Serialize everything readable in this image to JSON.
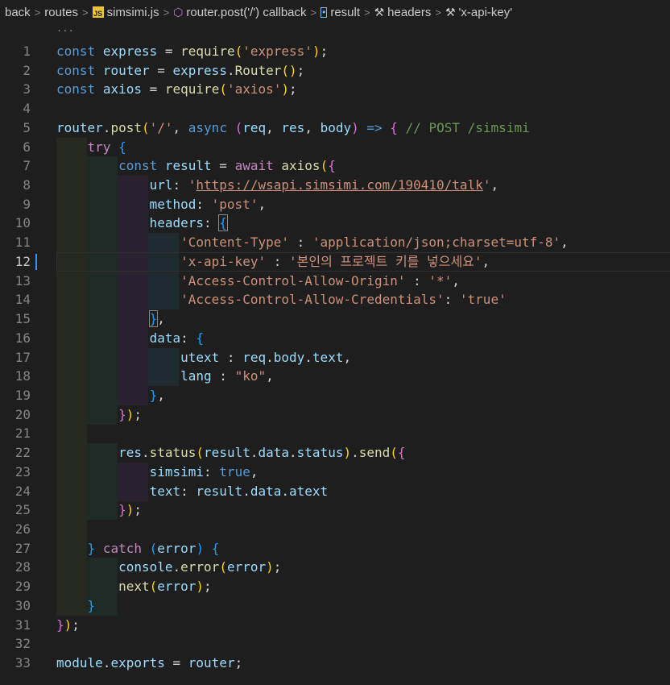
{
  "breadcrumb": {
    "items": [
      {
        "label": "back",
        "icon": null
      },
      {
        "label": "routes",
        "icon": null
      },
      {
        "label": "simsimi.js",
        "icon": "js-file-icon"
      },
      {
        "label": "router.post('/') callback",
        "icon": "cube-icon"
      },
      {
        "label": "result",
        "icon": "variable-icon"
      },
      {
        "label": "headers",
        "icon": "wrench-icon"
      },
      {
        "label": "'x-api-key'",
        "icon": "wrench-icon"
      }
    ],
    "separator": ">"
  },
  "editor": {
    "ellipsis": "...",
    "active_line": 12,
    "line_numbers": [
      "1",
      "2",
      "3",
      "4",
      "5",
      "6",
      "7",
      "8",
      "9",
      "10",
      "11",
      "12",
      "13",
      "14",
      "15",
      "16",
      "17",
      "18",
      "19",
      "20",
      "21",
      "22",
      "23",
      "24",
      "25",
      "26",
      "27",
      "28",
      "29",
      "30",
      "31",
      "32",
      "33"
    ],
    "lines": [
      [
        [
          "k",
          "const"
        ],
        [
          "o",
          " "
        ],
        [
          "v",
          "express"
        ],
        [
          "o",
          " = "
        ],
        [
          "f",
          "require"
        ],
        [
          "b1",
          "("
        ],
        [
          "s",
          "'express'"
        ],
        [
          "b1",
          ")"
        ],
        [
          "o",
          ";"
        ]
      ],
      [
        [
          "k",
          "const"
        ],
        [
          "o",
          " "
        ],
        [
          "v",
          "router"
        ],
        [
          "o",
          " = "
        ],
        [
          "v",
          "express"
        ],
        [
          "o",
          "."
        ],
        [
          "f",
          "Router"
        ],
        [
          "b1",
          "()"
        ],
        [
          "o",
          ";"
        ]
      ],
      [
        [
          "k",
          "const"
        ],
        [
          "o",
          " "
        ],
        [
          "v",
          "axios"
        ],
        [
          "o",
          " = "
        ],
        [
          "f",
          "require"
        ],
        [
          "b1",
          "("
        ],
        [
          "s",
          "'axios'"
        ],
        [
          "b1",
          ")"
        ],
        [
          "o",
          ";"
        ]
      ],
      [],
      [
        [
          "v",
          "router"
        ],
        [
          "o",
          "."
        ],
        [
          "f",
          "post"
        ],
        [
          "b1",
          "("
        ],
        [
          "s",
          "'/'"
        ],
        [
          "o",
          ", "
        ],
        [
          "k",
          "async"
        ],
        [
          "o",
          " "
        ],
        [
          "b2",
          "("
        ],
        [
          "v",
          "req"
        ],
        [
          "o",
          ", "
        ],
        [
          "v",
          "res"
        ],
        [
          "o",
          ", "
        ],
        [
          "v",
          "body"
        ],
        [
          "b2",
          ")"
        ],
        [
          "o",
          " "
        ],
        [
          "k",
          "=>"
        ],
        [
          "o",
          " "
        ],
        [
          "b2",
          "{"
        ],
        [
          "o",
          " "
        ],
        [
          "cm",
          "// POST /simsimi"
        ]
      ],
      [
        [
          "o",
          "    "
        ],
        [
          "c",
          "try"
        ],
        [
          "o",
          " "
        ],
        [
          "b3",
          "{"
        ]
      ],
      [
        [
          "o",
          "        "
        ],
        [
          "k",
          "const"
        ],
        [
          "o",
          " "
        ],
        [
          "v",
          "result"
        ],
        [
          "o",
          " = "
        ],
        [
          "c",
          "await"
        ],
        [
          "o",
          " "
        ],
        [
          "f",
          "axios"
        ],
        [
          "b1",
          "("
        ],
        [
          "b2",
          "{"
        ]
      ],
      [
        [
          "o",
          "            "
        ],
        [
          "v",
          "url"
        ],
        [
          "o",
          ": "
        ],
        [
          "s",
          "'"
        ],
        [
          "su",
          "https://wsapi.simsimi.com/190410/talk"
        ],
        [
          "s",
          "'"
        ],
        [
          "o",
          ","
        ]
      ],
      [
        [
          "o",
          "            "
        ],
        [
          "v",
          "method"
        ],
        [
          "o",
          ": "
        ],
        [
          "s",
          "'post'"
        ],
        [
          "o",
          ","
        ]
      ],
      [
        [
          "o",
          "            "
        ],
        [
          "v",
          "headers"
        ],
        [
          "o",
          ": "
        ],
        [
          "b3m",
          "{"
        ]
      ],
      [
        [
          "o",
          "                "
        ],
        [
          "s",
          "'Content-Type'"
        ],
        [
          "o",
          " : "
        ],
        [
          "s",
          "'application/json;charset=utf-8'"
        ],
        [
          "o",
          ","
        ]
      ],
      [
        [
          "o",
          "                "
        ],
        [
          "s",
          "'x-api-key'"
        ],
        [
          "o",
          " : "
        ],
        [
          "s",
          "'본인의 프로젝트 키를 넣으세요'"
        ],
        [
          "o",
          ","
        ]
      ],
      [
        [
          "o",
          "                "
        ],
        [
          "s",
          "'Access-Control-Allow-Origin'"
        ],
        [
          "o",
          " : "
        ],
        [
          "s",
          "'*'"
        ],
        [
          "o",
          ","
        ]
      ],
      [
        [
          "o",
          "                "
        ],
        [
          "s",
          "'Access-Control-Allow-Credentials'"
        ],
        [
          "o",
          ": "
        ],
        [
          "s",
          "'true'"
        ]
      ],
      [
        [
          "o",
          "            "
        ],
        [
          "b3m",
          "}"
        ],
        [
          "o",
          ","
        ]
      ],
      [
        [
          "o",
          "            "
        ],
        [
          "v",
          "data"
        ],
        [
          "o",
          ": "
        ],
        [
          "b3",
          "{"
        ]
      ],
      [
        [
          "o",
          "                "
        ],
        [
          "v",
          "utext"
        ],
        [
          "o",
          " : "
        ],
        [
          "v",
          "req"
        ],
        [
          "o",
          "."
        ],
        [
          "v",
          "body"
        ],
        [
          "o",
          "."
        ],
        [
          "v",
          "text"
        ],
        [
          "o",
          ","
        ]
      ],
      [
        [
          "o",
          "                "
        ],
        [
          "v",
          "lang"
        ],
        [
          "o",
          " : "
        ],
        [
          "s",
          "\"ko\""
        ],
        [
          "o",
          ","
        ]
      ],
      [
        [
          "o",
          "            "
        ],
        [
          "b3",
          "}"
        ],
        [
          "o",
          ","
        ]
      ],
      [
        [
          "o",
          "        "
        ],
        [
          "b2",
          "}"
        ],
        [
          "b1",
          ")"
        ],
        [
          "o",
          ";"
        ]
      ],
      [],
      [
        [
          "o",
          "        "
        ],
        [
          "v",
          "res"
        ],
        [
          "o",
          "."
        ],
        [
          "f",
          "status"
        ],
        [
          "b1",
          "("
        ],
        [
          "v",
          "result"
        ],
        [
          "o",
          "."
        ],
        [
          "v",
          "data"
        ],
        [
          "o",
          "."
        ],
        [
          "v",
          "status"
        ],
        [
          "b1",
          ")"
        ],
        [
          "o",
          "."
        ],
        [
          "f",
          "send"
        ],
        [
          "b1",
          "("
        ],
        [
          "b2",
          "{"
        ]
      ],
      [
        [
          "o",
          "            "
        ],
        [
          "v",
          "simsimi"
        ],
        [
          "o",
          ": "
        ],
        [
          "k",
          "true"
        ],
        [
          "o",
          ","
        ]
      ],
      [
        [
          "o",
          "            "
        ],
        [
          "v",
          "text"
        ],
        [
          "o",
          ": "
        ],
        [
          "v",
          "result"
        ],
        [
          "o",
          "."
        ],
        [
          "v",
          "data"
        ],
        [
          "o",
          "."
        ],
        [
          "v",
          "atext"
        ]
      ],
      [
        [
          "o",
          "        "
        ],
        [
          "b2",
          "}"
        ],
        [
          "b1",
          ")"
        ],
        [
          "o",
          ";"
        ]
      ],
      [],
      [
        [
          "o",
          "    "
        ],
        [
          "b3",
          "}"
        ],
        [
          "o",
          " "
        ],
        [
          "c",
          "catch"
        ],
        [
          "o",
          " "
        ],
        [
          "b3",
          "("
        ],
        [
          "v",
          "error"
        ],
        [
          "b3",
          ")"
        ],
        [
          "o",
          " "
        ],
        [
          "b3",
          "{"
        ]
      ],
      [
        [
          "o",
          "        "
        ],
        [
          "v",
          "console"
        ],
        [
          "o",
          "."
        ],
        [
          "f",
          "error"
        ],
        [
          "b1",
          "("
        ],
        [
          "v",
          "error"
        ],
        [
          "b1",
          ")"
        ],
        [
          "o",
          ";"
        ]
      ],
      [
        [
          "o",
          "        "
        ],
        [
          "f",
          "next"
        ],
        [
          "b1",
          "("
        ],
        [
          "v",
          "error"
        ],
        [
          "b1",
          ")"
        ],
        [
          "o",
          ";"
        ]
      ],
      [
        [
          "o",
          "    "
        ],
        [
          "b3",
          "}"
        ]
      ],
      [
        [
          "b2",
          "}"
        ],
        [
          "b1",
          ")"
        ],
        [
          "o",
          ";"
        ]
      ],
      [],
      [
        [
          "v",
          "module"
        ],
        [
          "o",
          "."
        ],
        [
          "v",
          "exports"
        ],
        [
          "o",
          " = "
        ],
        [
          "v",
          "router"
        ],
        [
          "o",
          ";"
        ]
      ]
    ]
  },
  "colors": {
    "background": "#1e1e1e",
    "keyword": "#569cd6",
    "control": "#c586c0",
    "variable": "#9cdcfe",
    "function": "#dcdcaa",
    "string": "#ce9178",
    "comment": "#6a9955",
    "bracket_1": "#ffd700",
    "bracket_2": "#da70d6",
    "bracket_3": "#179fff",
    "active_marker": "#3794ff"
  }
}
